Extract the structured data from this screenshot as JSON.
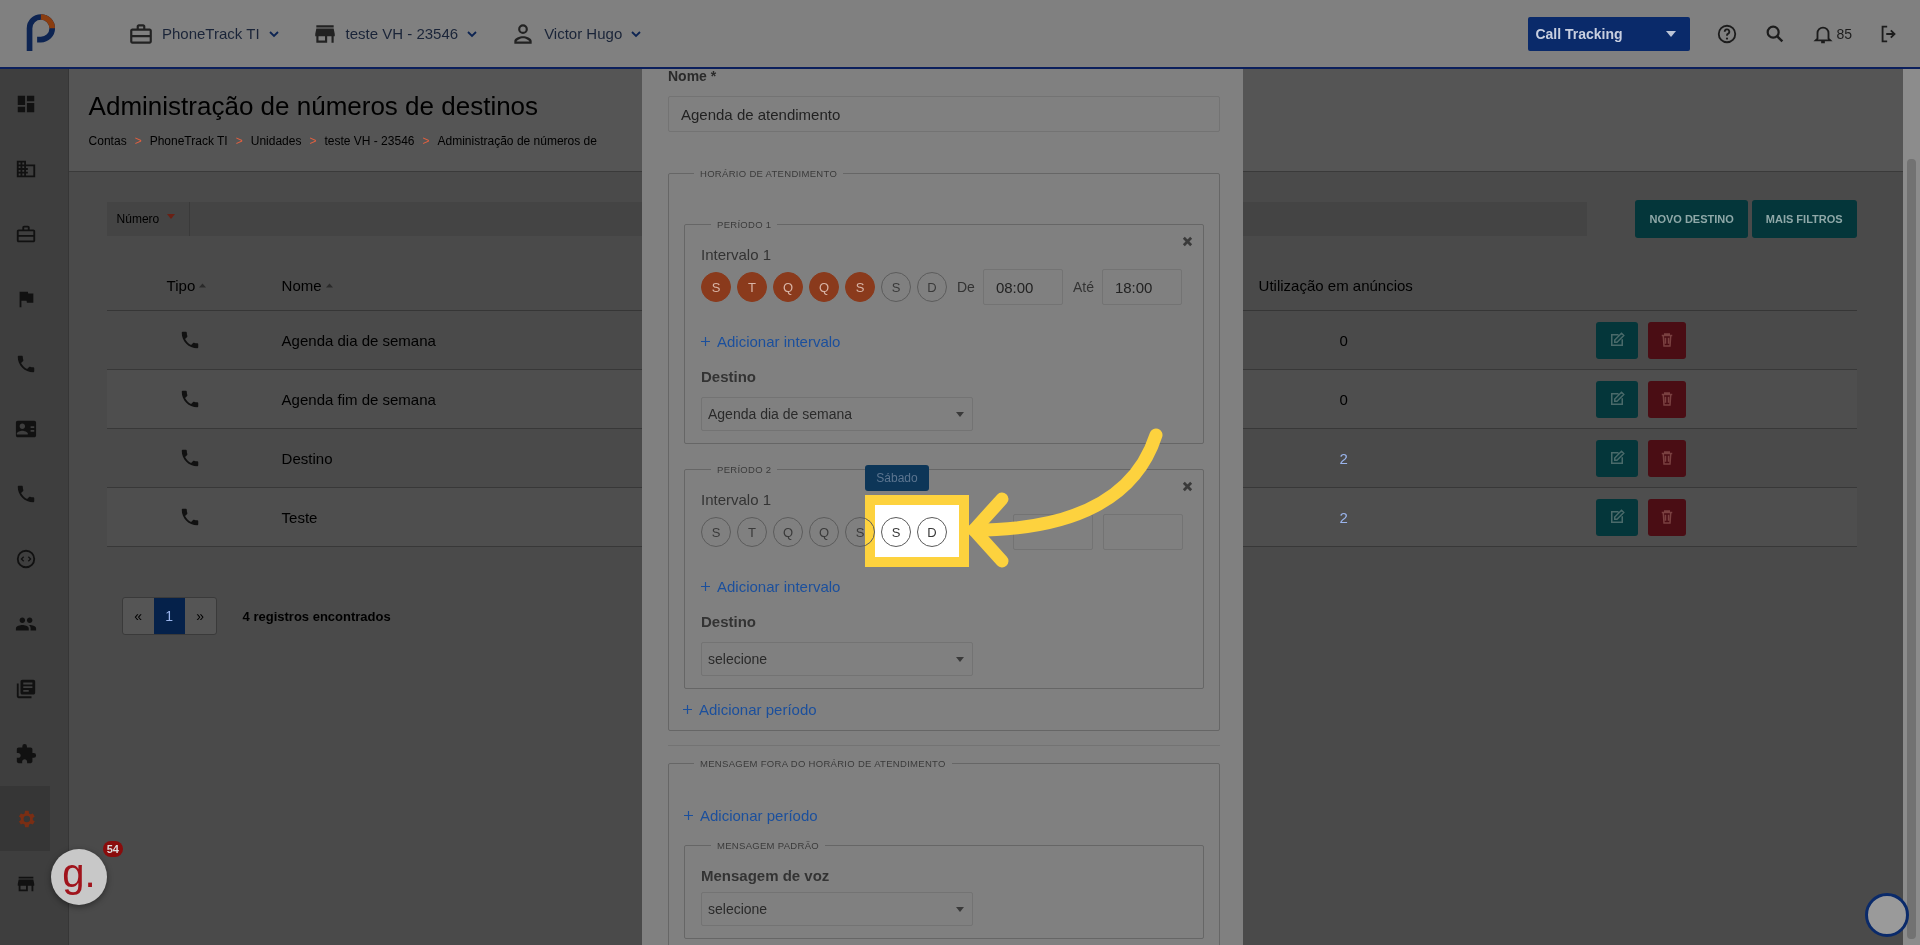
{
  "top_bar": {
    "menus": [
      {
        "label": "PhoneTrack TI"
      },
      {
        "label": "teste VH - 23546"
      },
      {
        "label": "Victor Hugo"
      }
    ],
    "product_select": "Call Tracking",
    "notification_count": "85"
  },
  "sidebar": {
    "items": [
      {
        "selected": false
      },
      {
        "selected": false
      },
      {
        "selected": false
      },
      {
        "selected": false
      },
      {
        "selected": false
      },
      {
        "selected": false
      },
      {
        "selected": false
      },
      {
        "selected": false
      },
      {
        "selected": false
      },
      {
        "selected": false
      },
      {
        "selected": false
      },
      {
        "selected": true
      },
      {
        "selected": false
      }
    ]
  },
  "page": {
    "title": "Administração de números de destinos",
    "breadcrumb": [
      "Contas",
      "PhoneTrack TI",
      "Unidades",
      "teste VH - 23546",
      "Administração de números de"
    ],
    "breadcrumb_separator": ">"
  },
  "filter": {
    "label": "Número"
  },
  "buttons": [
    "NOVO DESTINO",
    "MAIS FILTROS"
  ],
  "table": {
    "columns": [
      "Tipo",
      "Nome",
      "Utilização em anúncios"
    ],
    "rows": [
      {
        "name": "Agenda dia de semana",
        "usage": "0",
        "usage_linked": false
      },
      {
        "name": "Agenda fim de semana",
        "usage": "0",
        "usage_linked": false
      },
      {
        "name": "Destino",
        "usage": "2",
        "usage_linked": true
      },
      {
        "name": "Teste",
        "usage": "2",
        "usage_linked": true
      }
    ]
  },
  "pagination": {
    "prev": "«",
    "pages": [
      {
        "label": "1",
        "selected": true
      }
    ],
    "next": "»",
    "summary": "4 registros encontrados"
  },
  "modal": {
    "name_label": "Nome *",
    "name_value": "Agenda de atendimento",
    "schedule_legend": "HORÁRIO DE ATENDIMENTO",
    "periods": [
      {
        "legend": "PERÍODO 1",
        "interval_label": "Intervalo 1",
        "days": [
          {
            "label": "S",
            "selected": true
          },
          {
            "label": "T",
            "selected": true
          },
          {
            "label": "Q",
            "selected": true
          },
          {
            "label": "Q",
            "selected": true
          },
          {
            "label": "S",
            "selected": true
          },
          {
            "label": "S",
            "selected": false
          },
          {
            "label": "D",
            "selected": false
          }
        ],
        "from_label": "De",
        "from_value": "08:00",
        "to_label": "Até",
        "to_value": "18:00",
        "add_interval": "Adicionar intervalo",
        "destination_label": "Destino",
        "destination_value": "Agenda dia de semana"
      },
      {
        "legend": "PERÍODO 2",
        "interval_label": "Intervalo 1",
        "days": [
          {
            "label": "S",
            "selected": false
          },
          {
            "label": "T",
            "selected": false
          },
          {
            "label": "Q",
            "selected": false
          },
          {
            "label": "Q",
            "selected": false
          },
          {
            "label": "S",
            "selected": false
          },
          {
            "label": "S",
            "selected": false
          },
          {
            "label": "D",
            "selected": false
          }
        ],
        "tooltip": "Sábado",
        "add_interval": "Adicionar intervalo",
        "destination_label": "Destino",
        "destination_value": "selecione"
      }
    ],
    "add_period": "Adicionar período",
    "outside_legend": "MENSAGEM FORA DO HORÁRIO DE ATENDIMENTO",
    "outside_add_period": "Adicionar período",
    "default_legend": "MENSAGEM PADRÃO",
    "voice_label": "Mensagem de voz",
    "voice_value": "selecione"
  },
  "chat_widget": {
    "logo_text": "g.",
    "badge": "54"
  }
}
